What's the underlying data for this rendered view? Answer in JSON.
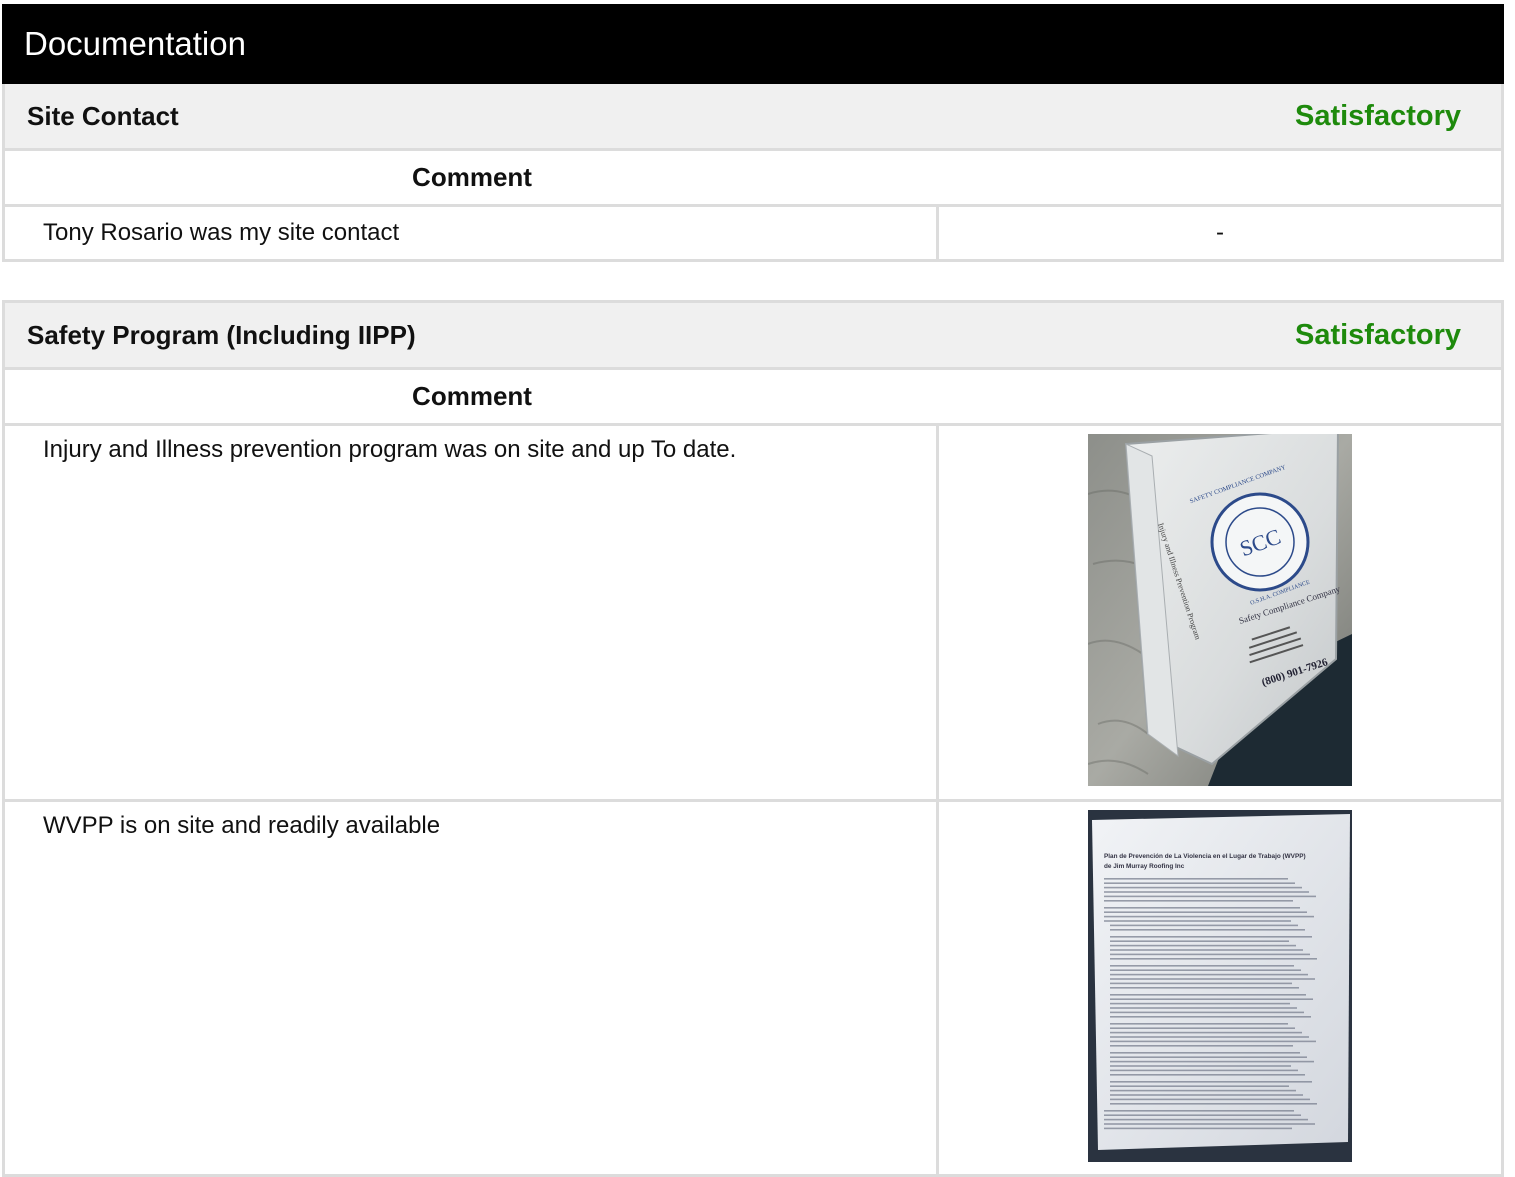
{
  "page": {
    "title": "Documentation"
  },
  "sections": [
    {
      "title": "Site Contact",
      "status": "Satisfactory",
      "comment_header": "Comment",
      "rows": [
        {
          "text": "Tony Rosario was my site contact",
          "media": "-"
        }
      ]
    },
    {
      "title": "Safety Program (Including IIPP)",
      "status": "Satisfactory",
      "comment_header": "Comment",
      "rows": [
        {
          "text": "Injury and Illness prevention program was on site and up To date."
        },
        {
          "text": "WVPP is on site and readily available"
        }
      ]
    }
  ],
  "photos": {
    "binder": {
      "logo_text": "SAFETY COMPLIANCE COMPANY",
      "logo_sub": "O.S.H.A. COMPLIANCE",
      "monogram": "SCC",
      "company": "Safety Compliance Company",
      "phone": "(800) 901-7926",
      "spine": "Injury and Illness Prevention Program"
    },
    "document": {
      "heading": "Plan de Prevención de La Violencia en el Lugar de Trabajo (WVPP)",
      "subheading": "de Jim Murray Roofing Inc"
    }
  },
  "colors": {
    "status_ok": "#1e8a0c",
    "title_bar": "#000000",
    "header_bg": "#f0f0f0",
    "border": "#dcdcdc"
  }
}
